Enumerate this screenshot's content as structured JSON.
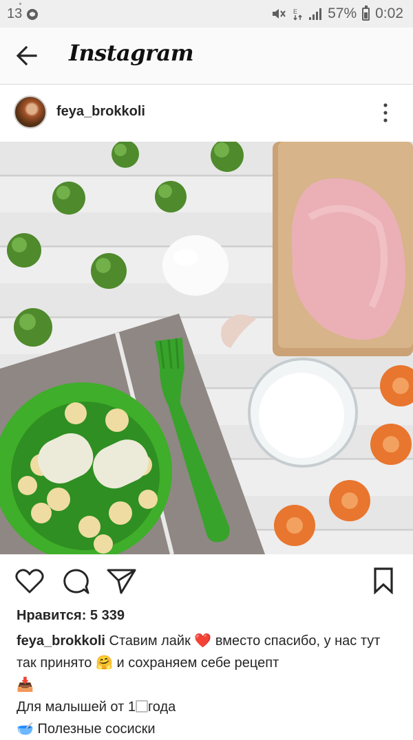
{
  "status_bar": {
    "temperature": "13",
    "temperature_unit": "°",
    "battery_percent": "57%",
    "battery_level": 0.57,
    "time": "0:02"
  },
  "app": {
    "title": "Instagram",
    "back_icon": "arrow-left-icon"
  },
  "post": {
    "username": "feya_brokkoli",
    "more_icon": "vertical-dots-icon",
    "likes_text": "Нравится: 5 339",
    "caption": {
      "user": "feya_brokkoli",
      "part1": "Ставим лайк",
      "emoji_heart": "❤️",
      "part2": "вместо спасибо, у нас тут так принято",
      "emoji_hug": "🤗",
      "part3": "и сохраняем себе рецепт",
      "emoji_inbox": "📥",
      "line2": "Для малышей от 1",
      "line2_end": "года",
      "emoji_bowl": "🥣",
      "line3": "Полезные сосиски"
    }
  },
  "icons": {
    "like": "heart-outline-icon",
    "comment": "comment-bubble-icon",
    "share": "paper-plane-icon",
    "save": "bookmark-icon"
  }
}
